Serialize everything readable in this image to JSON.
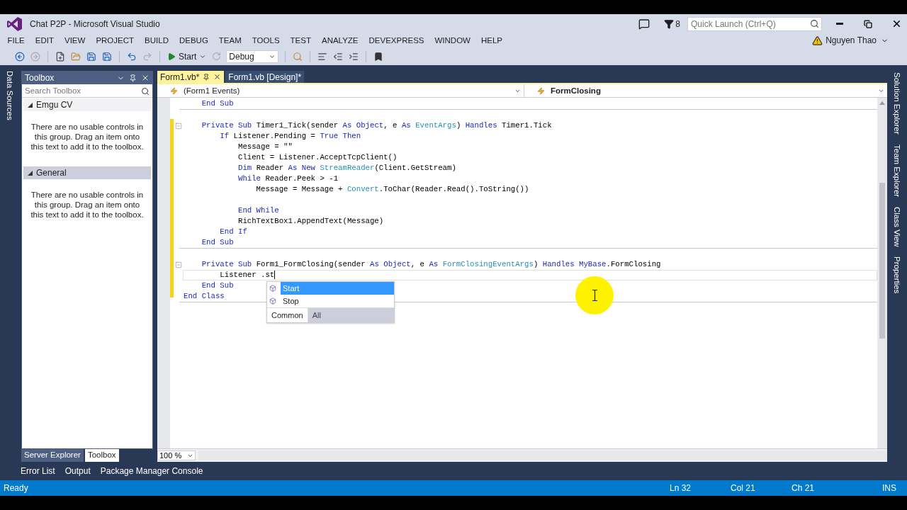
{
  "window": {
    "title": "Chat P2P - Microsoft Visual Studio",
    "notification_count": "8",
    "quick_launch": {
      "placeholder": "Quick Launch (Ctrl+Q)"
    }
  },
  "menu": [
    "FILE",
    "EDIT",
    "VIEW",
    "PROJECT",
    "BUILD",
    "DEBUG",
    "TEAM",
    "TOOLS",
    "TEST",
    "ANALYZE",
    "DEVEXPRESS",
    "WINDOW",
    "HELP"
  ],
  "user": {
    "name": "Nguyen Thao"
  },
  "toolbar": {
    "start_label": "Start",
    "configuration": "Debug"
  },
  "left_side_tabs": [
    "Data Sources"
  ],
  "toolbox": {
    "title": "Toolbox",
    "search": {
      "placeholder": "Search Toolbox"
    },
    "groups": [
      {
        "name": "Emgu CV",
        "expanded": true,
        "selected": false,
        "message": "There are no usable controls in this group. Drag an item onto this text to add it to the toolbox."
      },
      {
        "name": "General",
        "expanded": true,
        "selected": true,
        "message": "There are no usable controls in this group. Drag an item onto this text to add it to the toolbox."
      }
    ]
  },
  "toolbox_tabs": [
    {
      "label": "Server Explorer",
      "selected": false
    },
    {
      "label": "Toolbox",
      "selected": true
    }
  ],
  "editor": {
    "tabs": [
      {
        "label": "Form1.vb*",
        "selected": true
      },
      {
        "label": "Form1.vb [Design]*",
        "selected": false
      }
    ],
    "nav": {
      "object": "(Form1 Events)",
      "member": "FormClosing"
    },
    "lines": [
      {
        "kind": "code",
        "current": false,
        "tokens": [
          {
            "kind": "kw",
            "text": "    End Sub"
          }
        ]
      },
      {
        "kind": "separator"
      },
      {
        "kind": "blank"
      },
      {
        "kind": "fold",
        "current": false,
        "tokens": [
          {
            "kind": "kw",
            "text": "    Private Sub"
          },
          {
            "kind": "plain",
            "text": " Timer1_Tick(sender "
          },
          {
            "kind": "kw",
            "text": "As Object"
          },
          {
            "kind": "plain",
            "text": ", e "
          },
          {
            "kind": "kw",
            "text": "As "
          },
          {
            "kind": "type",
            "text": "EventArgs"
          },
          {
            "kind": "plain",
            "text": ") "
          },
          {
            "kind": "kw",
            "text": "Handles"
          },
          {
            "kind": "plain",
            "text": " Timer1.Tick"
          }
        ]
      },
      {
        "kind": "code",
        "current": false,
        "tokens": [
          {
            "kind": "kw",
            "text": "        If"
          },
          {
            "kind": "plain",
            "text": " Listener.Pending = "
          },
          {
            "kind": "kw",
            "text": "True Then"
          }
        ]
      },
      {
        "kind": "code",
        "current": false,
        "tokens": [
          {
            "kind": "plain",
            "text": "            Message = \"\""
          }
        ]
      },
      {
        "kind": "code",
        "current": false,
        "tokens": [
          {
            "kind": "plain",
            "text": "            Client = Listener.AcceptTcpClient()"
          }
        ]
      },
      {
        "kind": "code",
        "current": false,
        "tokens": [
          {
            "kind": "kw",
            "text": "            Dim"
          },
          {
            "kind": "plain",
            "text": " Reader "
          },
          {
            "kind": "kw",
            "text": "As New "
          },
          {
            "kind": "type",
            "text": "StreamReader"
          },
          {
            "kind": "plain",
            "text": "(Client.GetStream)"
          }
        ]
      },
      {
        "kind": "code",
        "current": false,
        "tokens": [
          {
            "kind": "kw",
            "text": "            While"
          },
          {
            "kind": "plain",
            "text": " Reader.Peek > -1"
          }
        ]
      },
      {
        "kind": "code",
        "current": false,
        "tokens": [
          {
            "kind": "plain",
            "text": "                Message = Message + "
          },
          {
            "kind": "type",
            "text": "Convert"
          },
          {
            "kind": "plain",
            "text": ".ToChar(Reader.Read().ToString())"
          }
        ]
      },
      {
        "kind": "blank"
      },
      {
        "kind": "code",
        "current": false,
        "tokens": [
          {
            "kind": "kw",
            "text": "            End While"
          }
        ]
      },
      {
        "kind": "code",
        "current": false,
        "tokens": [
          {
            "kind": "plain",
            "text": "            RichTextBox1.AppendText(Message)"
          }
        ]
      },
      {
        "kind": "code",
        "current": false,
        "tokens": [
          {
            "kind": "kw",
            "text": "        End If"
          }
        ]
      },
      {
        "kind": "code",
        "current": false,
        "tokens": [
          {
            "kind": "kw",
            "text": "    End Sub"
          }
        ]
      },
      {
        "kind": "separator"
      },
      {
        "kind": "blank"
      },
      {
        "kind": "fold",
        "current": false,
        "tokens": [
          {
            "kind": "kw",
            "text": "    Private Sub"
          },
          {
            "kind": "plain",
            "text": " Form1_FormClosing(sender "
          },
          {
            "kind": "kw",
            "text": "As Object"
          },
          {
            "kind": "plain",
            "text": ", e "
          },
          {
            "kind": "kw",
            "text": "As "
          },
          {
            "kind": "type",
            "text": "FormClosingEventArgs"
          },
          {
            "kind": "plain",
            "text": ") "
          },
          {
            "kind": "kw",
            "text": "Handles MyBase"
          },
          {
            "kind": "plain",
            "text": ".FormClosing"
          }
        ]
      },
      {
        "kind": "code",
        "current": true,
        "tokens": [
          {
            "kind": "plain",
            "text": "        Listener .st"
          }
        ]
      },
      {
        "kind": "code",
        "current": false,
        "tokens": [
          {
            "kind": "kw",
            "text": "    End Sub"
          }
        ]
      },
      {
        "kind": "code",
        "current": false,
        "tokens": [
          {
            "kind": "kw",
            "text": "End Class"
          }
        ]
      },
      {
        "kind": "separator"
      }
    ],
    "completion": {
      "items": [
        {
          "label": "Start",
          "selected": true
        },
        {
          "label": "Stop",
          "selected": false
        }
      ],
      "filters": [
        {
          "label": "Common",
          "selected": false
        },
        {
          "label": "All",
          "selected": true
        }
      ]
    },
    "zoom": "100 %"
  },
  "right_side_tabs": [
    "Solution Explorer",
    "Team Explorer",
    "Class View",
    "Properties"
  ],
  "bottom_tabs": [
    "Error List",
    "Output",
    "Package Manager Console"
  ],
  "status_bar": {
    "message": "Ready",
    "line": "Ln 32",
    "column": "Col 21",
    "char": "Ch 21",
    "mode": "INS"
  }
}
